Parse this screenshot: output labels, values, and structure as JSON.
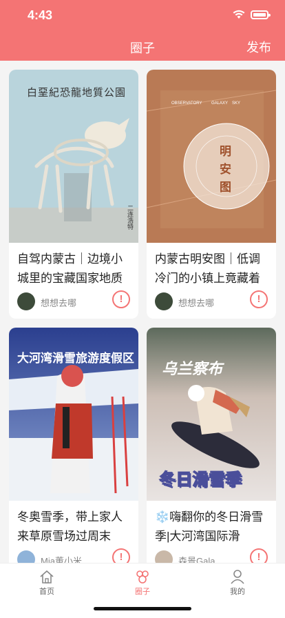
{
  "status_bar": {
    "time": "4:43"
  },
  "header": {
    "title": "圈子",
    "publish_label": "发布"
  },
  "colors": {
    "accent": "#f47474"
  },
  "posts": [
    {
      "title": "自驾内蒙古｜边境小城里的宝藏国家地质",
      "author": "想想去哪",
      "image_text": [
        "白堊紀恐龍地質公園",
        "二连浩特"
      ],
      "report_icon": "exclamation-circle-icon"
    },
    {
      "title": "内蒙古明安图｜低调冷门的小镇上竟藏着",
      "author": "想想去哪",
      "image_text": [
        "OBSERVATORY",
        "GALAXY",
        "SKY",
        "明",
        "安",
        "图"
      ],
      "report_icon": "exclamation-circle-icon"
    },
    {
      "title": "冬奥雪季，带上家人来草原雪场过周末",
      "author": "Mia董小米",
      "image_text": [
        "大河湾滑雪旅游度假区"
      ],
      "report_icon": "exclamation-circle-icon"
    },
    {
      "title": "❄️嗨翻你的冬日滑雪季|大河湾国际滑",
      "author": "森景Gala",
      "image_text": [
        "乌兰察布",
        "冬日滑雪季"
      ],
      "report_icon": "exclamation-circle-icon"
    }
  ],
  "tabbar": {
    "items": [
      {
        "label": "首页",
        "icon": "home-icon"
      },
      {
        "label": "圈子",
        "icon": "circle-group-icon",
        "active": true
      },
      {
        "label": "我的",
        "icon": "user-icon"
      }
    ]
  }
}
